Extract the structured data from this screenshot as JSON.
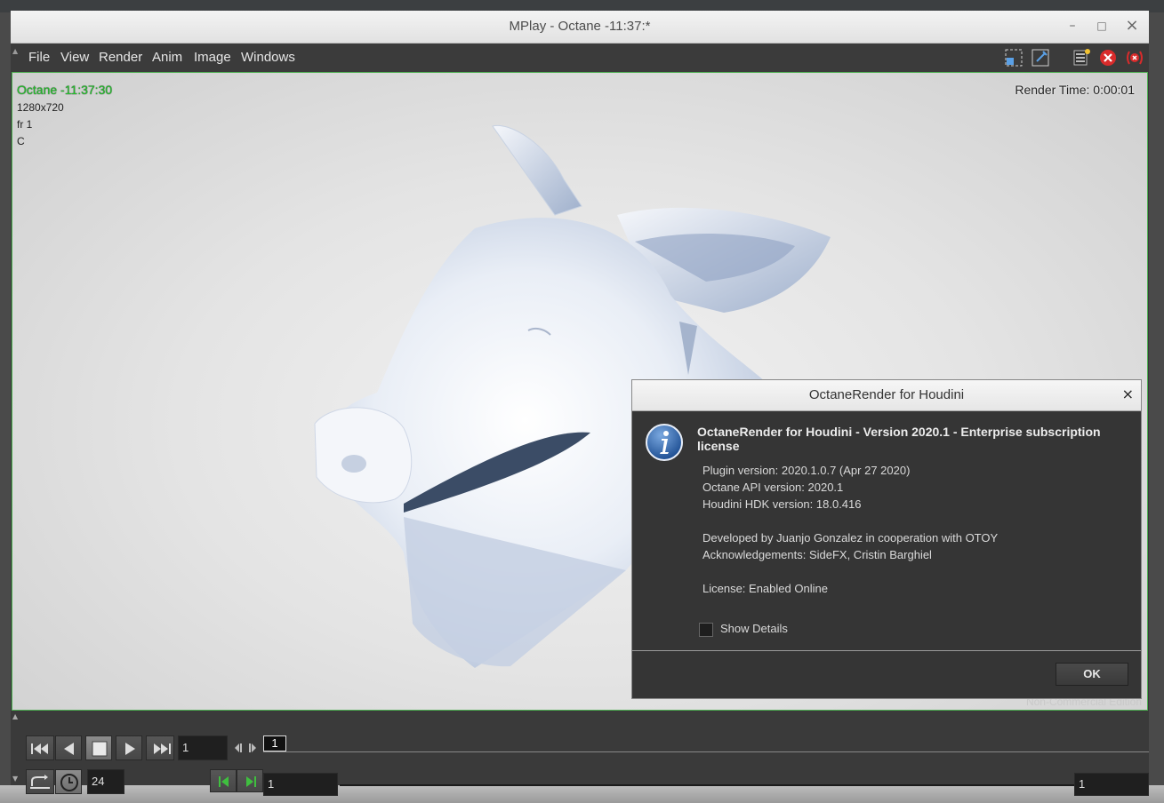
{
  "window": {
    "title": "MPlay - Octane -11:37:*",
    "controls": {
      "minimize": "–",
      "maximize": "□",
      "close": "×"
    }
  },
  "menu": {
    "items": [
      "File",
      "View",
      "Render",
      "Anim",
      "Image",
      "Windows"
    ]
  },
  "viewport": {
    "overlay_title": "Octane -11:37:30",
    "resolution": "1280x720",
    "frame": "fr 1",
    "channel": "C",
    "render_time": "Render Time: 0:00:01",
    "watermark": "Non-Commercial Edition"
  },
  "dialog": {
    "title": "OctaneRender for Houdini",
    "close": "×",
    "heading": "OctaneRender for Houdini - Version 2020.1 - Enterprise subscription license",
    "lines": [
      "Plugin version: 2020.1.0.7 (Apr 27 2020)",
      "Octane API version: 2020.1",
      "Houdini HDK version: 18.0.416",
      "Developed by Juanjo Gonzalez in cooperation with OTOY",
      "Acknowledgements: SideFX, Cristin Barghiel",
      "License: Enabled Online"
    ],
    "show_details_label": "Show Details",
    "show_details_checked": false,
    "ok_label": "OK"
  },
  "timeline": {
    "current_frame": "1",
    "frame_marker": "1",
    "fps": "24",
    "range_start": "1",
    "range_end": "1"
  },
  "colors": {
    "accent_green": "#22c02a",
    "viewport_border": "#4caf50",
    "close_red": "#d92b2b"
  }
}
